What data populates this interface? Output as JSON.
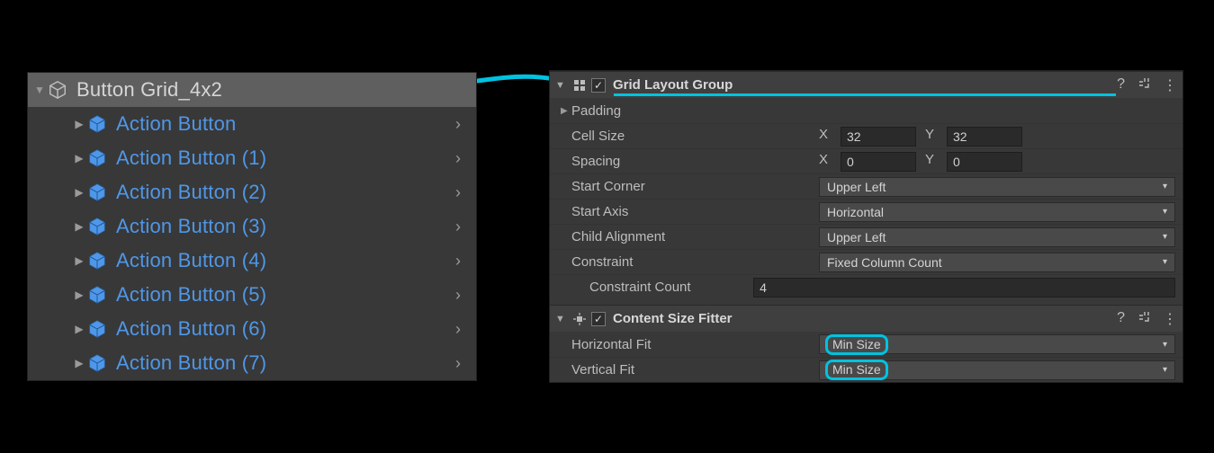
{
  "hierarchy": {
    "root": "Button Grid_4x2",
    "children": [
      "Action Button",
      "Action Button (1)",
      "Action Button (2)",
      "Action Button (3)",
      "Action Button (4)",
      "Action Button (5)",
      "Action Button (6)",
      "Action Button (7)"
    ]
  },
  "components": {
    "grid": {
      "title": "Grid Layout Group",
      "enabled": "✓",
      "padding_label": "Padding",
      "cell_size_label": "Cell Size",
      "cell_size": {
        "x": "32",
        "y": "32"
      },
      "spacing_label": "Spacing",
      "spacing": {
        "x": "0",
        "y": "0"
      },
      "start_corner_label": "Start Corner",
      "start_corner": "Upper Left",
      "start_axis_label": "Start Axis",
      "start_axis": "Horizontal",
      "child_align_label": "Child Alignment",
      "child_align": "Upper Left",
      "constraint_label": "Constraint",
      "constraint": "Fixed Column Count",
      "constraint_count_label": "Constraint Count",
      "constraint_count": "4"
    },
    "fitter": {
      "title": "Content Size Fitter",
      "enabled": "✓",
      "hfit_label": "Horizontal Fit",
      "hfit": "Min Size",
      "vfit_label": "Vertical Fit",
      "vfit": "Min Size"
    }
  },
  "axis": {
    "x": "X",
    "y": "Y"
  },
  "colors": {
    "highlight": "#00c2e0",
    "prefab_blue": "#4f97e8"
  }
}
